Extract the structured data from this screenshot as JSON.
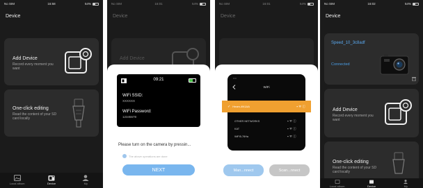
{
  "screen1": {
    "status": {
      "carrier": "No SIM",
      "time": "16:58",
      "battery": "54%"
    },
    "title": "Device",
    "add_device": {
      "title": "Add Device",
      "subtitle": "Record every moment you want"
    },
    "one_click": {
      "title": "One-click editing",
      "subtitle": "Read the content of your SD card locally"
    },
    "tabs": [
      "Local album",
      "Device",
      "My"
    ]
  },
  "screen2": {
    "status": {
      "carrier": "No SIM",
      "time": "16:01",
      "battery": "54%"
    },
    "title": "Device",
    "bg_card": "Add Device",
    "camera_time": "09:21",
    "wifi_ssid_label": "WiFi SSID:",
    "wifi_ssid_value": "XXXXXX",
    "wifi_password_label": "WiFi Password:",
    "wifi_password_value": "12345678",
    "instruction": "Please turn on the camera by pressin...",
    "checkbox_label": "The above operations are done",
    "next_button": "NEXT"
  },
  "screen3": {
    "status": {
      "carrier": "No SIM",
      "time": "16:01",
      "battery": "54%"
    },
    "title": "Device",
    "wifi_title": "WiFi",
    "connected_network": "Heam-4N1AA",
    "other_networks_label": "OTHER NETWORKS",
    "networks": [
      "KAT",
      "WiFi5-76Ha"
    ],
    "manual_button": "Man...nnect",
    "scan_button": "Scan...nnect"
  },
  "screen4": {
    "status": {
      "carrier": "No SIM",
      "time": "16:02",
      "battery": "54%"
    },
    "title": "Device",
    "device_name": "Speed_10_3c8adf",
    "device_status": "Connected",
    "add_device": {
      "title": "Add Device",
      "subtitle": "Record every moment you want"
    },
    "one_click": {
      "title": "One-click editing",
      "subtitle": "Read the content of your SD card locally"
    },
    "tabs": [
      "Local album",
      "Device",
      "My"
    ]
  },
  "colors": {
    "accent_blue": "#4a9fe8",
    "highlight_orange": "#f0a030",
    "dark_bg": "#1b1b1b",
    "card_bg": "#2c2c2c"
  }
}
